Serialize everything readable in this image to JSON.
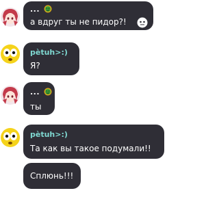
{
  "colors": {
    "bubble": "#2f2e36",
    "text": "#ffffff",
    "petuh_name": "#7fd9d2",
    "badge_green": "#3ea83a",
    "badge_gold": "#d8a11a"
  },
  "messages": [
    {
      "author": "...",
      "avatar": "anime-girl-pink-hair-avatar",
      "badge": "green-face-badge-icon",
      "text": "а вдруг ты не пидор?!",
      "trailing_emoji": "skull-face-emoji-icon"
    },
    {
      "author": "pètuh>:)",
      "avatar": "yellow-shocked-face-avatar",
      "text": "Я?"
    },
    {
      "author": "...",
      "avatar": "anime-girl-pink-hair-avatar",
      "badge": "green-face-badge-icon",
      "text": "ты"
    },
    {
      "author": "pètuh>:)",
      "avatar": "yellow-shocked-face-avatar",
      "text": "Та как вы такое подумали!!"
    },
    {
      "text": "Сплюнь!!!"
    }
  ]
}
